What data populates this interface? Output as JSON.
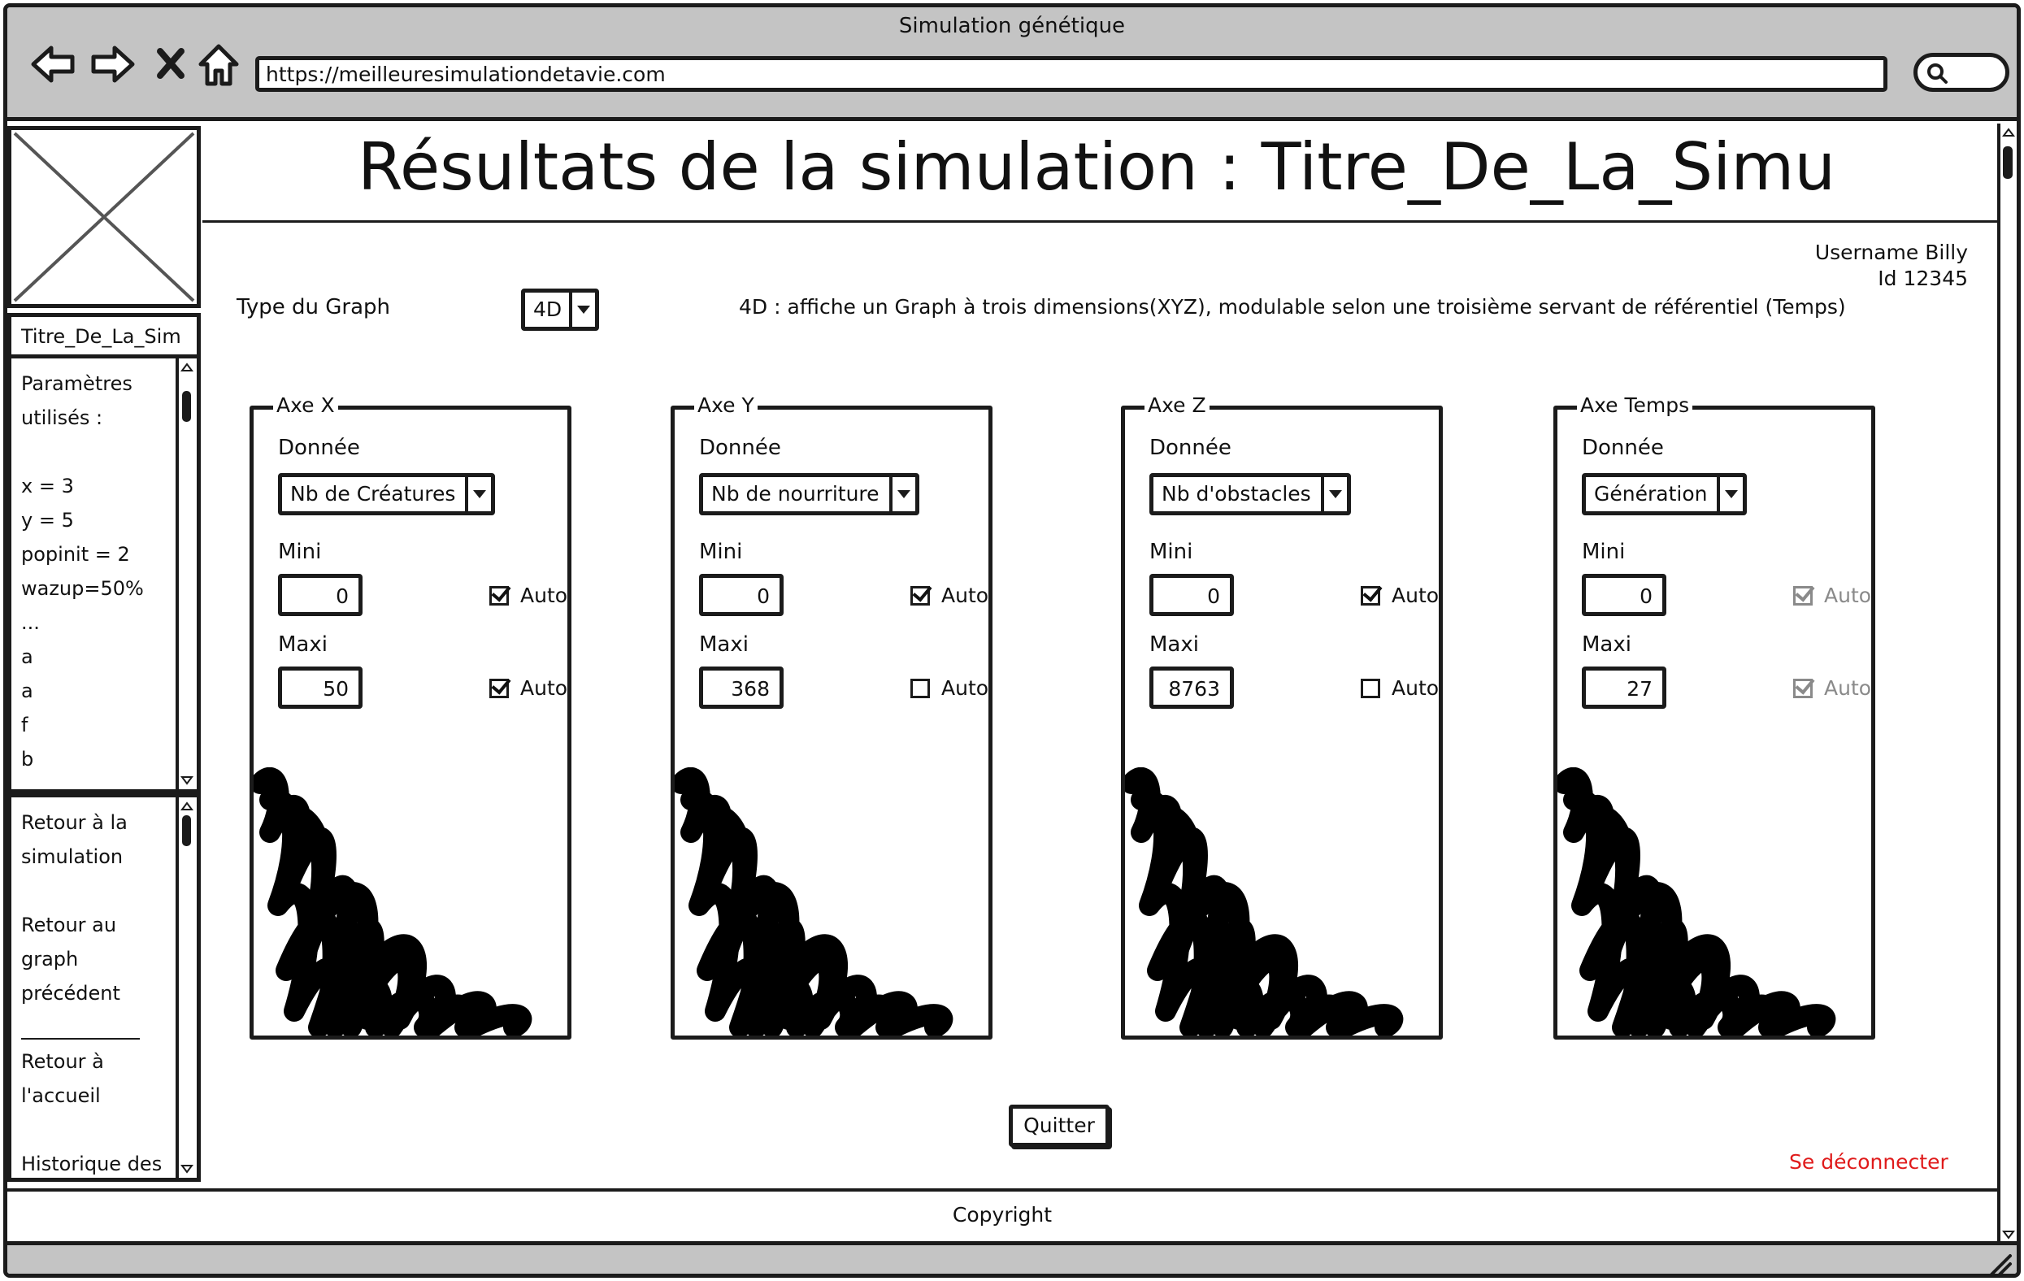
{
  "window": {
    "title": "Simulation génétique",
    "url": "https://meilleuresimulationdetavie.com"
  },
  "sidebar": {
    "tab_label": "Titre_De_La_Sim",
    "params_lines": [
      "Paramètres",
      "utilisés :",
      "",
      "x = 3",
      "y = 5",
      "popinit = 2",
      "wazup=50%",
      "...",
      "a",
      "a",
      "f",
      "b"
    ],
    "nav_lines": [
      "Retour à la",
      "simulation",
      "",
      "Retour au",
      "graph",
      "précédent",
      "",
      "Retour à",
      "l'accueil",
      "",
      "Historique des"
    ]
  },
  "header": {
    "title": "Résultats de la simulation : Titre_De_La_Simu"
  },
  "user": {
    "name": "Username Billy",
    "id": "Id 12345"
  },
  "graph_type": {
    "label": "Type du Graph",
    "selected": "4D",
    "description": "4D : affiche un Graph à trois dimensions(XYZ), modulable selon une troisième servant de référentiel (Temps)"
  },
  "labels": {
    "donnee": "Donnée",
    "mini": "Mini",
    "maxi": "Maxi",
    "auto": "Auto"
  },
  "axes": [
    {
      "legend": "Axe X",
      "data": "Nb de Créatures",
      "mini": "0",
      "maxi": "50",
      "mini_auto": true,
      "maxi_auto": true,
      "disabled": false
    },
    {
      "legend": "Axe Y",
      "data": "Nb de nourriture",
      "mini": "0",
      "maxi": "368",
      "mini_auto": true,
      "maxi_auto": false,
      "disabled": false
    },
    {
      "legend": "Axe Z",
      "data": "Nb d'obstacles",
      "mini": "0",
      "maxi": "8763",
      "mini_auto": true,
      "maxi_auto": false,
      "disabled": false
    },
    {
      "legend": "Axe Temps",
      "data": "Génération",
      "mini": "0",
      "maxi": "27",
      "mini_auto": true,
      "maxi_auto": true,
      "disabled": true
    }
  ],
  "actions": {
    "quit": "Quitter",
    "logout": "Se déconnecter"
  },
  "footer": {
    "text": "Copyright"
  },
  "colors": {
    "chrome": "#c4c4c4",
    "ink": "#1b1b1b",
    "logout": "#e01b1b",
    "disabled": "#8a8a8a"
  }
}
